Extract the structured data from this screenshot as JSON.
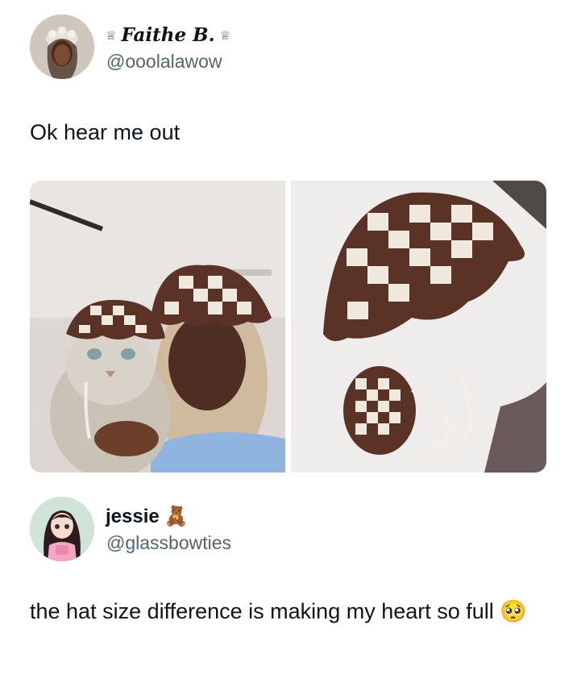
{
  "tweet1": {
    "display_name": "Faithe B.",
    "name_decoration_icon": "crown-icon",
    "handle": "@ooolalawow",
    "text": "Ok hear me out",
    "media": [
      {
        "description_icon": "photo-woman-with-cat-in-crochet-hats"
      },
      {
        "description_icon": "photo-two-checkered-crochet-hats"
      }
    ]
  },
  "tweet2": {
    "display_name": "jessie",
    "name_emoji": "🧸",
    "handle": "@glassbowties",
    "text": "the hat size difference is making my heart so full",
    "text_emoji": "🥺"
  },
  "colors": {
    "text_primary": "#0f1419",
    "text_secondary": "#536471",
    "hat_brown": "#5a3226",
    "hat_cream": "#efe8dc"
  }
}
